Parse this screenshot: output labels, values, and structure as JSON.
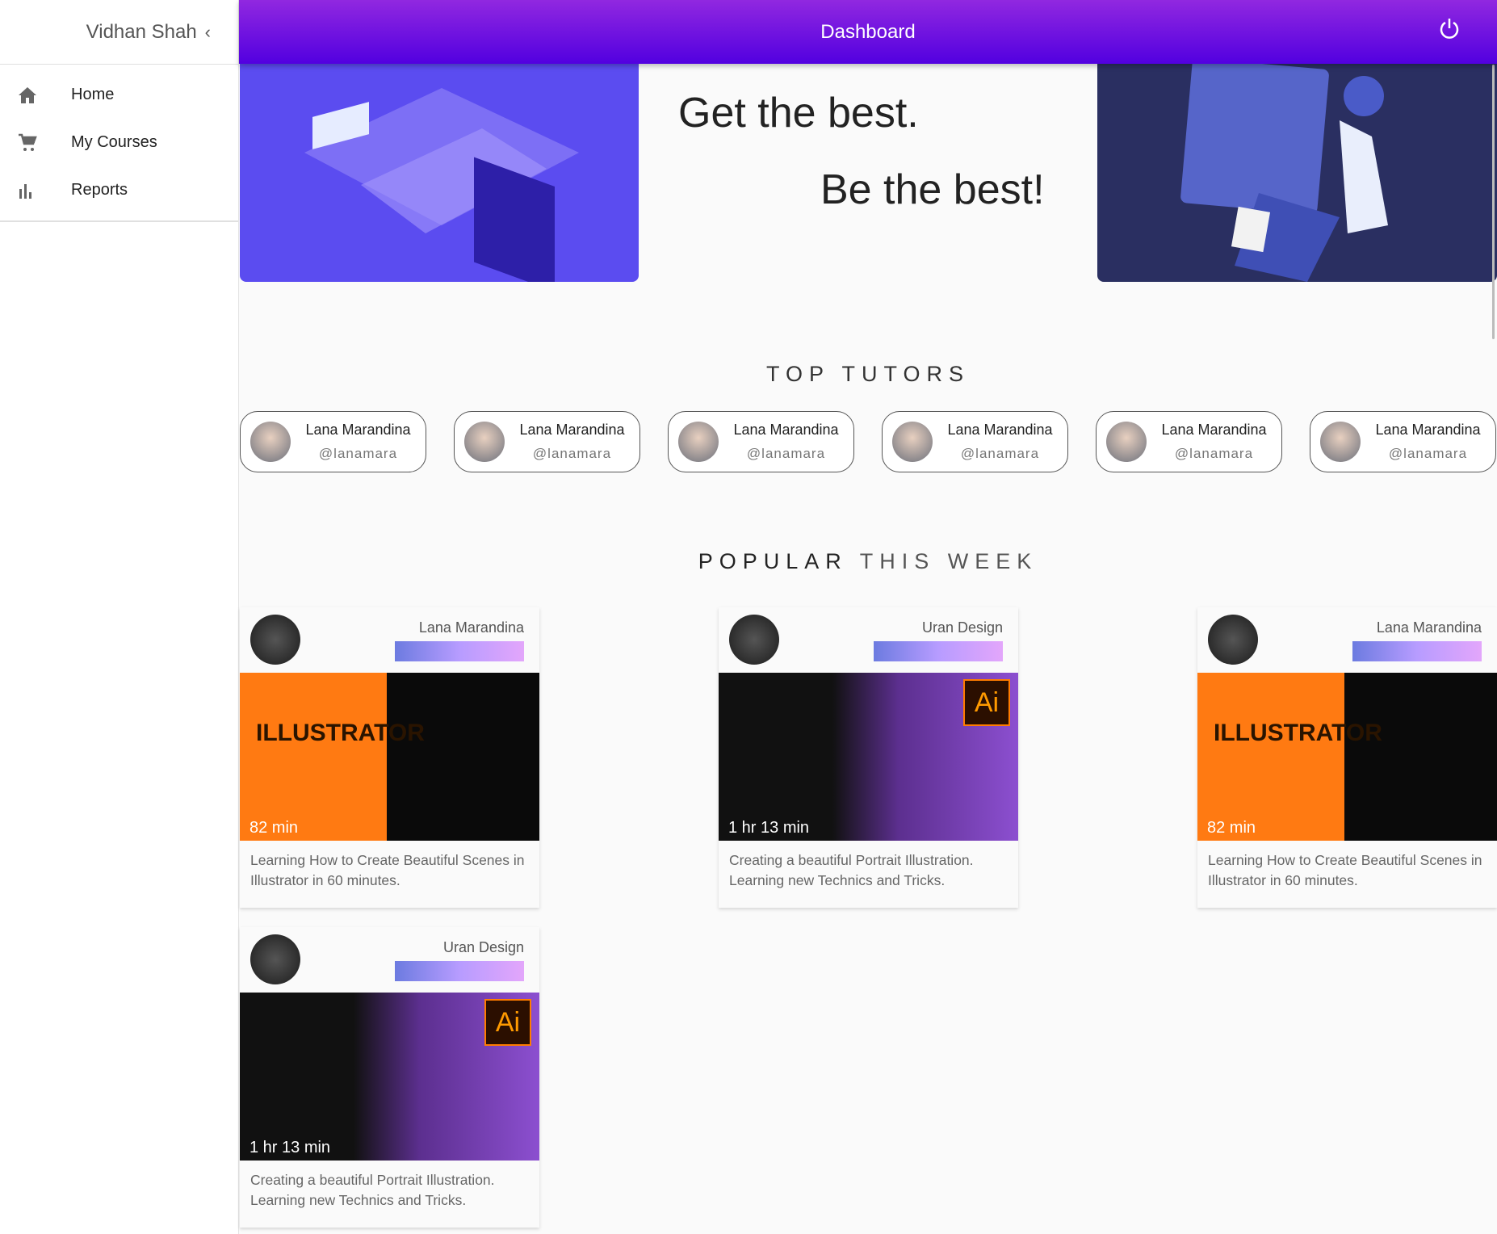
{
  "sidebar": {
    "user": "Vidhan Shah",
    "items": [
      {
        "label": "Home",
        "icon": "home-icon"
      },
      {
        "label": "My Courses",
        "icon": "cart-icon"
      },
      {
        "label": "Reports",
        "icon": "bar-chart-icon"
      }
    ]
  },
  "header": {
    "title": "Dashboard",
    "icon": "power-icon"
  },
  "hero": {
    "line1": "Get the best.",
    "line2": "Be the best!"
  },
  "tutors": {
    "title": "TOP TUTORS",
    "items": [
      {
        "name": "Lana Marandina",
        "handle": "@lanamara"
      },
      {
        "name": "Lana Marandina",
        "handle": "@lanamara"
      },
      {
        "name": "Lana Marandina",
        "handle": "@lanamara"
      },
      {
        "name": "Lana Marandina",
        "handle": "@lanamara"
      },
      {
        "name": "Lana Marandina",
        "handle": "@lanamara"
      },
      {
        "name": "Lana Marandina",
        "handle": "@lanamara"
      }
    ]
  },
  "popular": {
    "title_bold": "POPULAR",
    "title_light": " THIS WEEK",
    "cards": [
      {
        "author": "Lana Marandina",
        "duration": "82 min",
        "image_text": "ILLUSTRATOR",
        "desc": "Learning How to Create Beautiful Scenes in Illustrator in 60 minutes."
      },
      {
        "author": "Uran Design",
        "duration": "1 hr 13 min",
        "image_text": "Ai",
        "desc": "Creating a beautiful Portrait Illustration. Learning new Technics and Tricks."
      },
      {
        "author": "Lana Marandina",
        "duration": "82 min",
        "image_text": "ILLUSTRATOR",
        "desc": "Learning How to Create Beautiful Scenes in Illustrator in 60 minutes."
      },
      {
        "author": "Uran Design",
        "duration": "1 hr 13 min",
        "image_text": "Ai",
        "desc": "Creating a beautiful Portrait Illustration. Learning new Technics and Tricks."
      }
    ]
  }
}
